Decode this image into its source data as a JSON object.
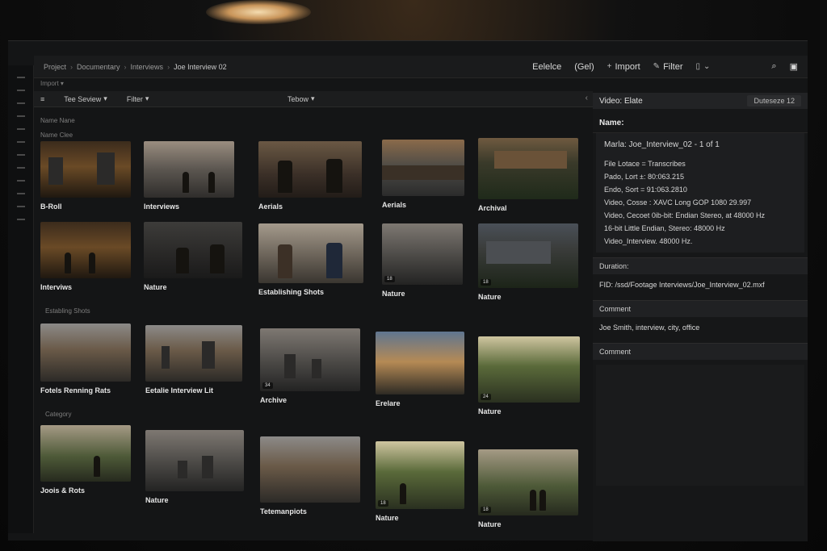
{
  "breadcrumb": [
    "Project",
    "Documentary",
    "Interviews",
    "Joe Interview 02"
  ],
  "topbar": {
    "select_label": "Eelelce",
    "gel_label": "(Gel)",
    "import_label": "Import",
    "filter_label": "Filter"
  },
  "import_row": "Import",
  "toolbar": {
    "view_label": "Tee Seview",
    "filter_label": "Filter",
    "center_label": "Tebow"
  },
  "sections": {
    "name_header": "Name Nane",
    "name_sub": "Name Clee",
    "establishing": "Establing Shots",
    "category": "Category"
  },
  "rows": [
    {
      "clips": [
        {
          "label": "B-Roll",
          "badge": ""
        },
        {
          "label": "Interviews",
          "badge": ""
        },
        {
          "label": "Aerials",
          "badge": ""
        },
        {
          "label": "Aerials",
          "badge": ""
        },
        {
          "label": "Archival",
          "badge": ""
        }
      ]
    },
    {
      "clips": [
        {
          "label": "Interviws",
          "badge": ""
        },
        {
          "label": "Nature",
          "badge": ""
        },
        {
          "label": "Establishing Shots",
          "badge": ""
        },
        {
          "label": "Nature",
          "badge": "18"
        },
        {
          "label": "Nature",
          "badge": "18"
        }
      ]
    },
    {
      "clips": [
        {
          "label": "Fotels Renning Rats",
          "badge": ""
        },
        {
          "label": "Eetalie Interview Lit",
          "badge": ""
        },
        {
          "label": "Archive",
          "badge": "34"
        },
        {
          "label": "Erelare",
          "badge": ""
        },
        {
          "label": "Nature",
          "badge": "24"
        }
      ]
    },
    {
      "clips": [
        {
          "label": "Joois & Rots",
          "badge": ""
        },
        {
          "label": "Nature",
          "badge": ""
        },
        {
          "label": "Tetemanpiots",
          "badge": ""
        },
        {
          "label": "Nature",
          "badge": "18"
        },
        {
          "label": "Nature",
          "badge": "18"
        }
      ]
    }
  ],
  "inspector": {
    "header_title": "Video: Elate",
    "header_duration": "Duteseze 12",
    "name_title": "Name:",
    "name_value": "Marla: Joe_Interview_02 - 1 of 1",
    "meta_lines": [
      "File Lotace = Transcribes",
      "Pado, Lort ±: 80:063.215",
      "Endo, Sort = 91:063.2810",
      "Video, Cosse : XAVC Long GOP 1080 29.997",
      "Video, Cecoet 0ib-bit: Endian Stereo, at 48000 Hz",
      "16-bit Little Endian, Stereo: 48000 Hz",
      "Video_Interview. 48000 Hz."
    ],
    "duration_label": "Duration:",
    "file_path": "FID: /ssd/Footage Interviews/Joe_Interview_02.mxf",
    "comment_label": "Comment",
    "comment_value": "Joe Smith, interview, city, office",
    "comment2_label": "Comment"
  }
}
